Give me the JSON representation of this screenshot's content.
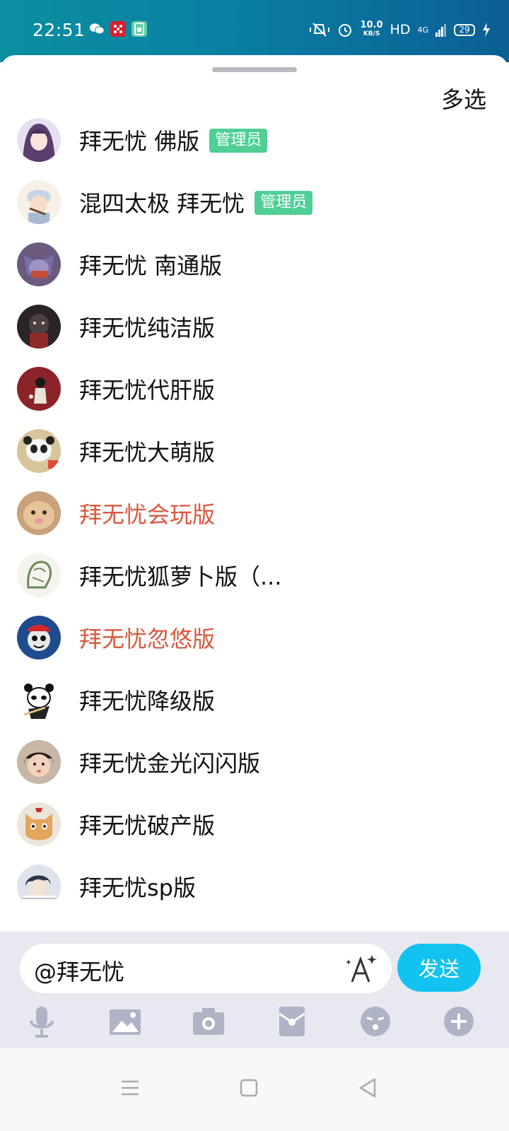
{
  "status_bar": {
    "time": "22:51",
    "speed_value": "10.0",
    "speed_unit": "KB/S",
    "network_hd": "HD",
    "network_type": "4G",
    "battery": "29"
  },
  "sheet": {
    "multi_select_label": "多选"
  },
  "members": [
    {
      "name": "拜无忧 佛版",
      "badge": "管理员",
      "color": "black"
    },
    {
      "name": "混四太极  拜无忧",
      "badge": "管理员",
      "color": "black"
    },
    {
      "name": "拜无忧 南通版",
      "badge": "",
      "color": "black"
    },
    {
      "name": "拜无忧纯洁版",
      "badge": "",
      "color": "black"
    },
    {
      "name": "拜无忧代肝版",
      "badge": "",
      "color": "black"
    },
    {
      "name": "拜无忧大萌版",
      "badge": "",
      "color": "black"
    },
    {
      "name": "拜无忧会玩版",
      "badge": "",
      "color": "red"
    },
    {
      "name": "拜无忧狐萝卜版（...",
      "badge": "",
      "color": "black"
    },
    {
      "name": "拜无忧忽悠版",
      "badge": "",
      "color": "red"
    },
    {
      "name": "拜无忧降级版",
      "badge": "",
      "color": "black"
    },
    {
      "name": "拜无忧金光闪闪版",
      "badge": "",
      "color": "black"
    },
    {
      "name": "拜无忧破产版",
      "badge": "",
      "color": "black"
    },
    {
      "name": "拜无忧sp版",
      "badge": "",
      "color": "black"
    }
  ],
  "input": {
    "value": "@拜无忧",
    "send_label": "发送"
  },
  "toolbar_icons": [
    "microphone-icon",
    "image-icon",
    "camera-icon",
    "red-packet-icon",
    "emoji-icon",
    "plus-icon"
  ],
  "colors": {
    "accent": "#12c2f1",
    "badge": "#4fcf95",
    "highlight_name": "#d9583e"
  }
}
